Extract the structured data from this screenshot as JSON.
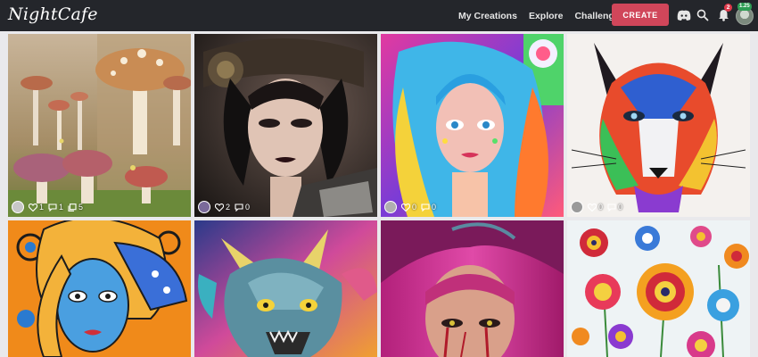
{
  "nav": {
    "brand": "NightCafe",
    "links": [
      "My Creations",
      "Explore",
      "Challenges"
    ],
    "create_label": "CREATE",
    "notification_count": "2",
    "credits": "1.25"
  },
  "gallery": {
    "cards": [
      {
        "likes": "1",
        "comments": "1",
        "collections": "5"
      },
      {
        "likes": "2",
        "comments": "0"
      },
      {
        "likes": "0",
        "comments": "0"
      },
      {
        "likes": "0",
        "comments": "0"
      }
    ]
  },
  "colors": {
    "navbar": "#24262b",
    "create": "#d0465a",
    "badge": "#e0394b",
    "credits": "#2e9d54"
  }
}
